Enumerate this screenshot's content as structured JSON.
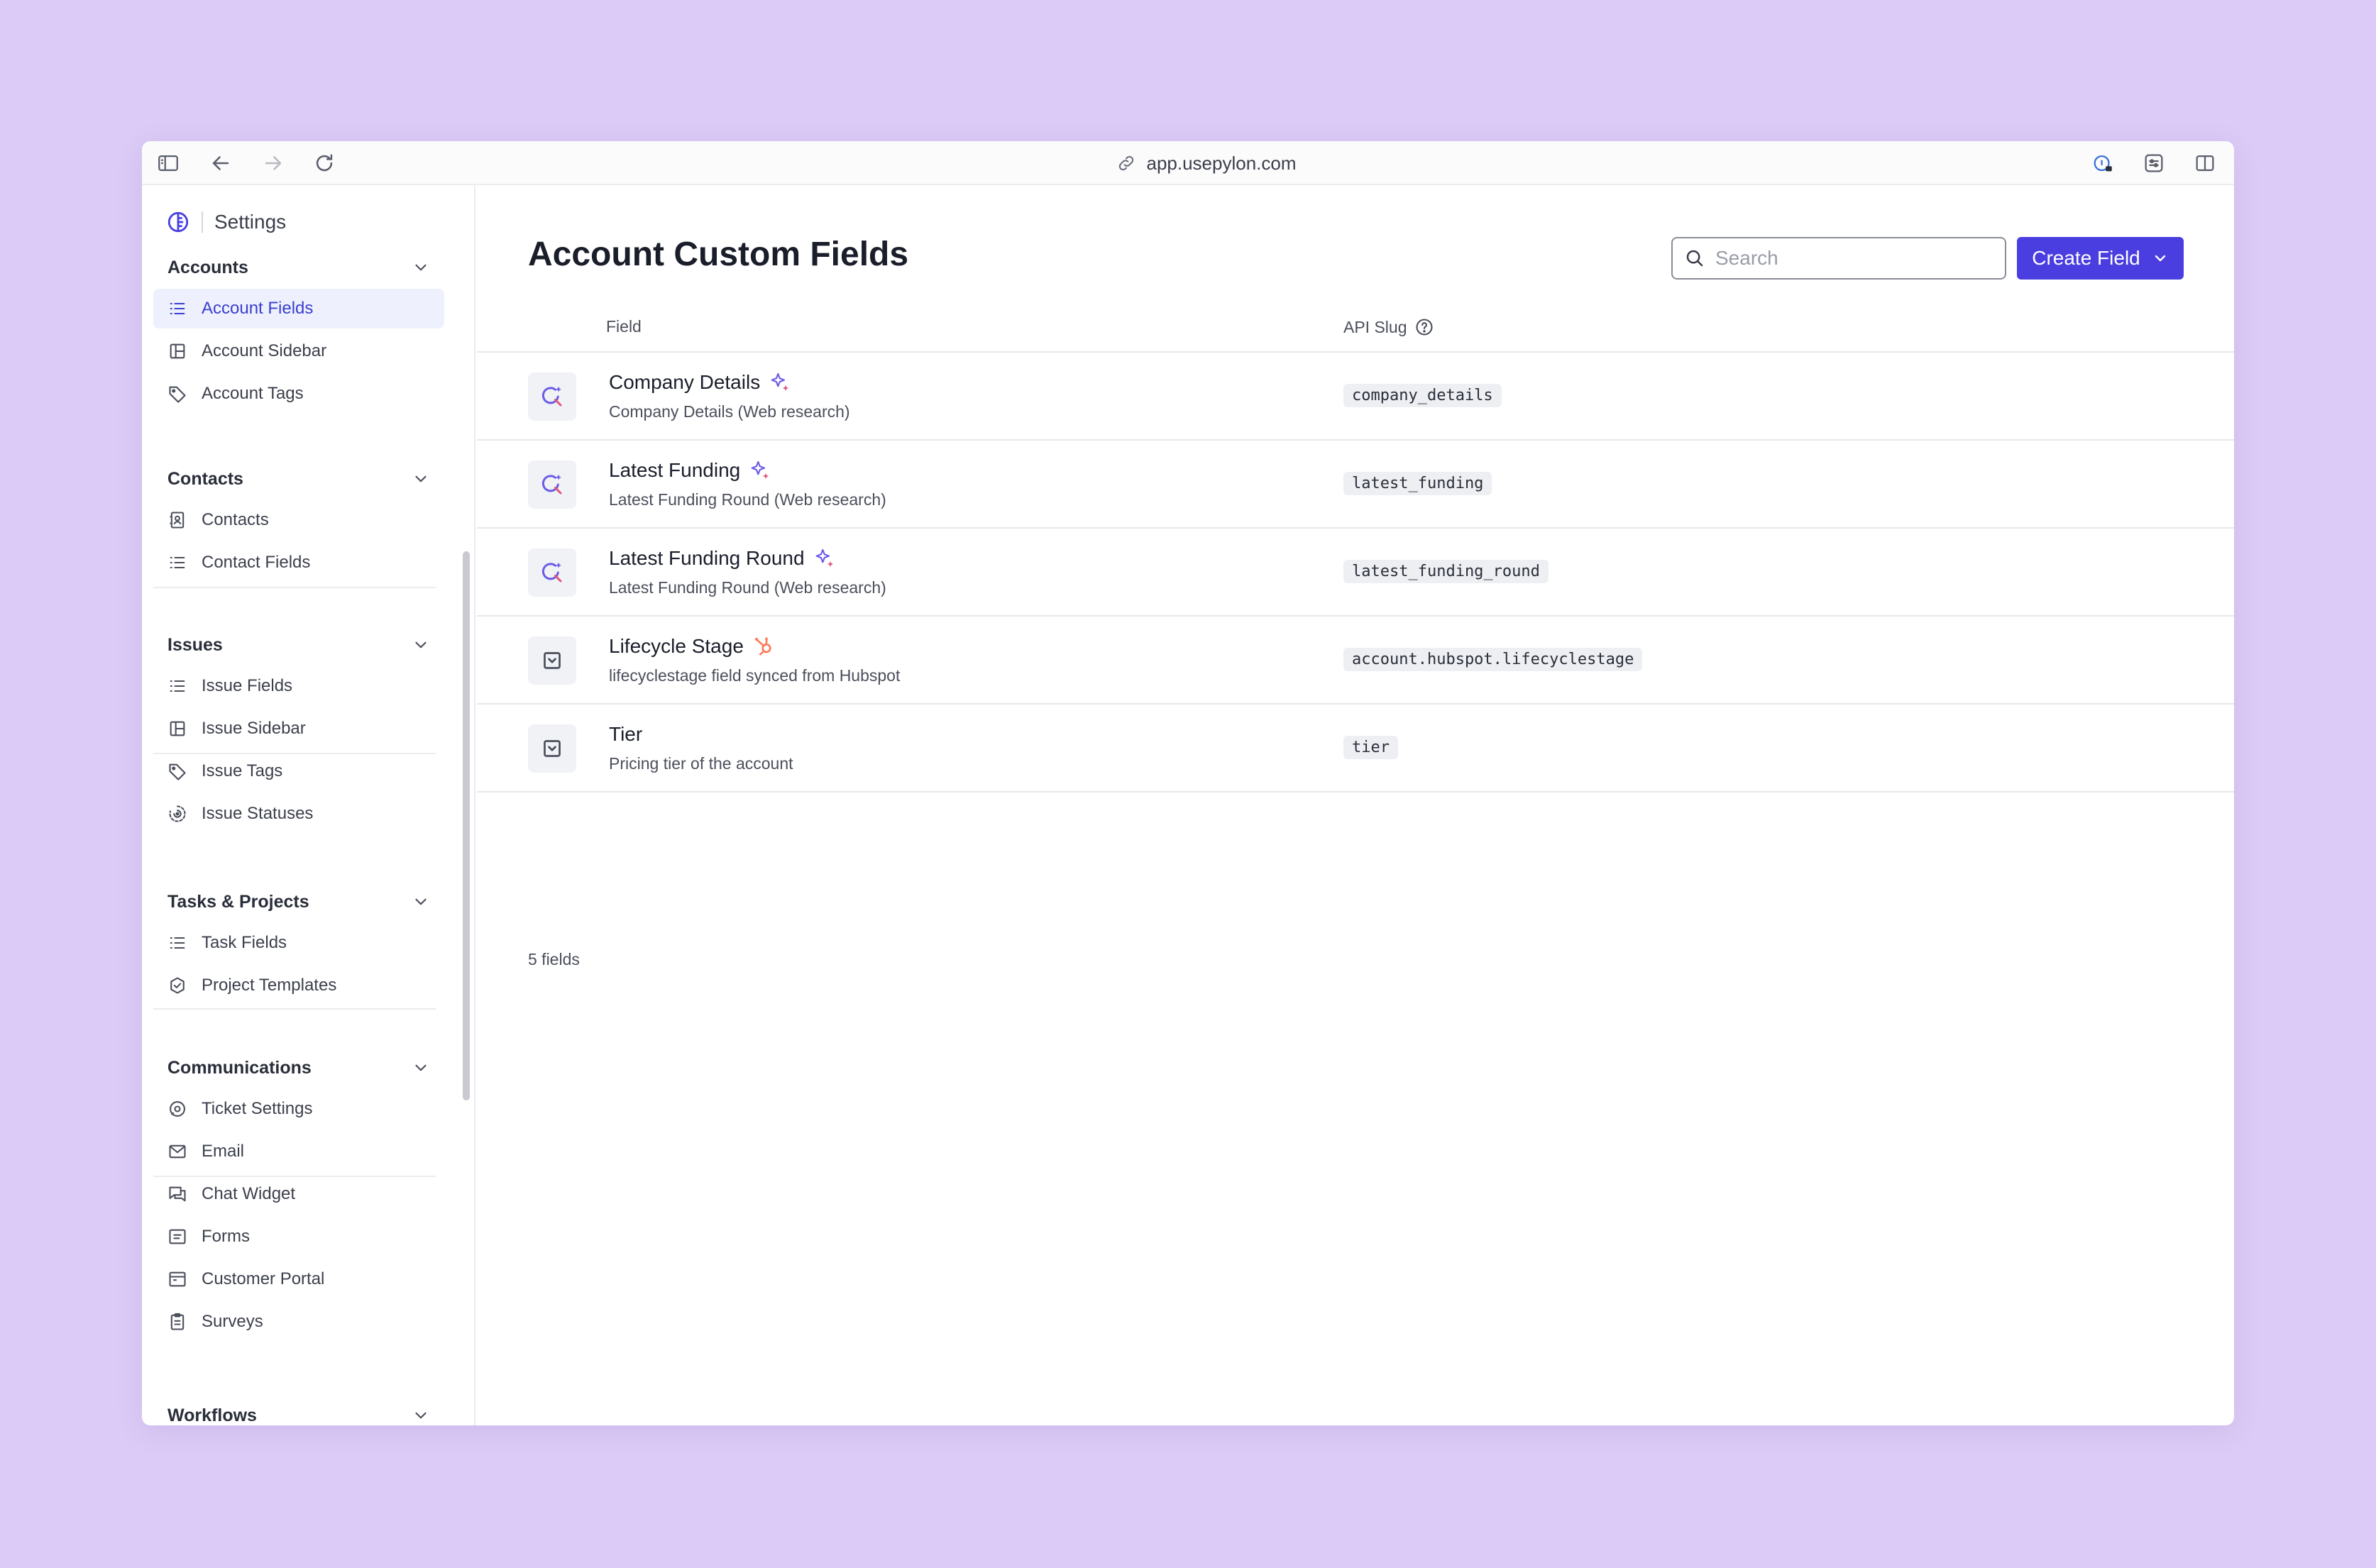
{
  "browser": {
    "url": "app.usepylon.com"
  },
  "sidebar": {
    "title": "Settings",
    "sections": [
      {
        "label": "Accounts",
        "items": [
          {
            "label": "Account Fields",
            "icon": "list-icon",
            "active": true
          },
          {
            "label": "Account Sidebar",
            "icon": "layout-icon"
          },
          {
            "label": "Account Tags",
            "icon": "tag-icon"
          }
        ]
      },
      {
        "label": "Contacts",
        "items": [
          {
            "label": "Contacts",
            "icon": "contact-book-icon"
          },
          {
            "label": "Contact Fields",
            "icon": "list-icon"
          }
        ]
      },
      {
        "label": "Issues",
        "items": [
          {
            "label": "Issue Fields",
            "icon": "list-icon"
          },
          {
            "label": "Issue Sidebar",
            "icon": "layout-icon"
          },
          {
            "label": "Issue Tags",
            "icon": "tag-icon"
          },
          {
            "label": "Issue Statuses",
            "icon": "status-icon"
          }
        ]
      },
      {
        "label": "Tasks & Projects",
        "items": [
          {
            "label": "Task Fields",
            "icon": "list-icon"
          },
          {
            "label": "Project Templates",
            "icon": "badge-check-icon"
          }
        ]
      },
      {
        "label": "Communications",
        "items": [
          {
            "label": "Ticket Settings",
            "icon": "ticket-settings-icon"
          },
          {
            "label": "Email",
            "icon": "mail-icon"
          },
          {
            "label": "Chat Widget",
            "icon": "chat-icon"
          },
          {
            "label": "Forms",
            "icon": "form-icon"
          },
          {
            "label": "Customer Portal",
            "icon": "portal-icon"
          },
          {
            "label": "Surveys",
            "icon": "clipboard-icon"
          }
        ]
      },
      {
        "label": "Workflows",
        "items": []
      }
    ]
  },
  "main": {
    "title": "Account Custom Fields",
    "search_placeholder": "Search",
    "create_button_label": "Create Field",
    "columns": {
      "field": "Field",
      "api_slug": "API Slug"
    },
    "rows": [
      {
        "name": "Company Details",
        "description": "Company Details (Web research)",
        "slug": "company_details",
        "icon": "web-research-icon",
        "badge": "sparkle-icon"
      },
      {
        "name": "Latest Funding",
        "description": "Latest Funding Round (Web research)",
        "slug": "latest_funding",
        "icon": "web-research-icon",
        "badge": "sparkle-icon"
      },
      {
        "name": "Latest Funding Round",
        "description": "Latest Funding Round (Web research)",
        "slug": "latest_funding_round",
        "icon": "web-research-icon",
        "badge": "sparkle-icon"
      },
      {
        "name": "Lifecycle Stage",
        "description": "lifecyclestage field synced from Hubspot",
        "slug": "account.hubspot.lifecyclestage",
        "icon": "select-icon",
        "badge": "hubspot-icon"
      },
      {
        "name": "Tier",
        "description": "Pricing tier of the account",
        "slug": "tier",
        "icon": "select-icon",
        "badge": ""
      }
    ],
    "count_label": "5 fields"
  },
  "colors": {
    "background": "#dccbf6",
    "accent": "#4a3ee0",
    "active_item_bg": "#eef0fd",
    "hubspot": "#ff7a59"
  }
}
